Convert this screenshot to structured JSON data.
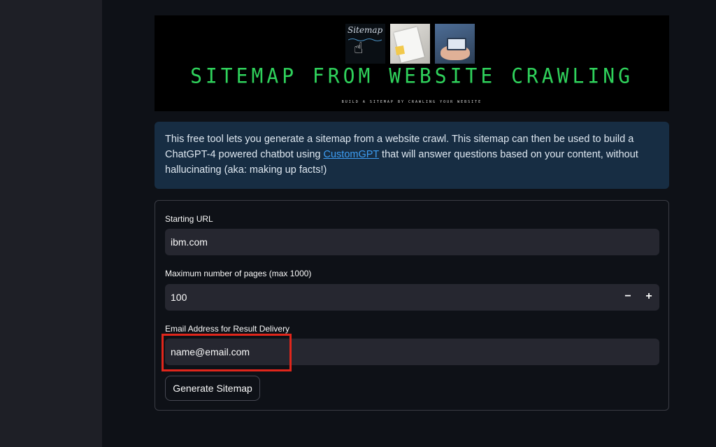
{
  "banner": {
    "image_label": "Sitemap",
    "title": "SITEMAP FROM WEBSITE CRAWLING",
    "subtitle": "BUILD A SITEMAP BY CRAWLING YOUR WEBSITE"
  },
  "info": {
    "text_before": "This free tool lets you generate a sitemap from a website crawl. This sitemap can then be used to build a ChatGPT-4 powered chatbot using ",
    "link_text": "CustomGPT",
    "text_after": " that will answer questions based on your content, without hallucinating (aka: making up facts!)"
  },
  "form": {
    "url_label": "Starting URL",
    "url_value": "ibm.com",
    "pages_label": "Maximum number of pages (max 1000)",
    "pages_value": "100",
    "minus": "−",
    "plus": "+",
    "email_label": "Email Address for Result Delivery",
    "email_value": "name@email.com",
    "submit_label": "Generate Sitemap"
  },
  "colors": {
    "background": "#0e1117",
    "sidebar": "#1e1f26",
    "banner_title": "#2fd15b",
    "info_bg": "#172d43",
    "link": "#3d9df3",
    "highlight": "#e0261b"
  }
}
